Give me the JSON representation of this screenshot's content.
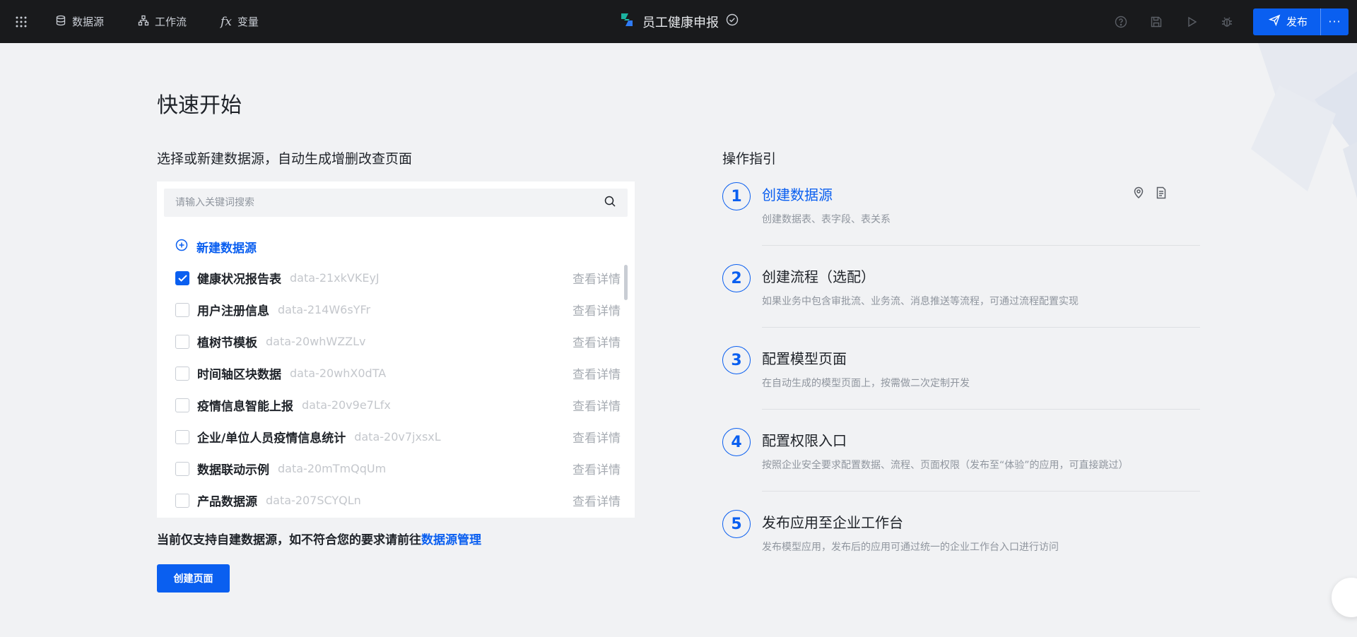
{
  "colors": {
    "accent": "#0a5ff0",
    "topbar": "#191a1c",
    "background": "#f1f2f4"
  },
  "topbar": {
    "apps_icon": "apps-grid-icon",
    "nav": [
      {
        "label": "数据源",
        "icon": "database-icon"
      },
      {
        "label": "工作流",
        "icon": "workflow-icon"
      },
      {
        "label": "变量",
        "icon": "fx-variable-icon"
      }
    ],
    "app_title": "员工健康申报",
    "publish_label": "发布",
    "more_label": "···"
  },
  "main": {
    "title": "快速开始",
    "subtitle": "选择或新建数据源，自动生成增删改查页面",
    "search_placeholder": "请输入关键词搜索",
    "new_datasource_label": "新建数据源",
    "detail_label": "查看详情",
    "datasources": [
      {
        "name": "健康状况报告表",
        "id": "data-21xkVKEyJ",
        "checked": true
      },
      {
        "name": "用户注册信息",
        "id": "data-214W6sYFr",
        "checked": false
      },
      {
        "name": "植树节模板",
        "id": "data-20whWZZLv",
        "checked": false
      },
      {
        "name": "时间轴区块数据",
        "id": "data-20whX0dTA",
        "checked": false
      },
      {
        "name": "疫情信息智能上报",
        "id": "data-20v9e7Lfx",
        "checked": false
      },
      {
        "name": "企业/单位人员疫情信息统计",
        "id": "data-20v7jxsxL",
        "checked": false
      },
      {
        "name": "数据联动示例",
        "id": "data-20mTmQqUm",
        "checked": false
      },
      {
        "name": "产品数据源",
        "id": "data-207SCYQLn",
        "checked": false
      }
    ],
    "note_text": "当前仅支持自建数据源，如不符合您的要求请前往",
    "note_link": "数据源管理",
    "create_button": "创建页面"
  },
  "guide": {
    "title": "操作指引",
    "steps": [
      {
        "num": "1",
        "title": "创建数据源",
        "desc": "创建数据表、表字段、表关系"
      },
      {
        "num": "2",
        "title": "创建流程（选配）",
        "desc": "如果业务中包含审批流、业务流、消息推送等流程，可通过流程配置实现"
      },
      {
        "num": "3",
        "title": "配置模型页面",
        "desc": "在自动生成的模型页面上，按需做二次定制开发"
      },
      {
        "num": "4",
        "title": "配置权限入口",
        "desc": "按照企业安全要求配置数据、流程、页面权限（发布至“体验”的应用，可直接跳过）"
      },
      {
        "num": "5",
        "title": "发布应用至企业工作台",
        "desc": "发布模型应用，发布后的应用可通过统一的企业工作台入口进行访问"
      }
    ]
  }
}
